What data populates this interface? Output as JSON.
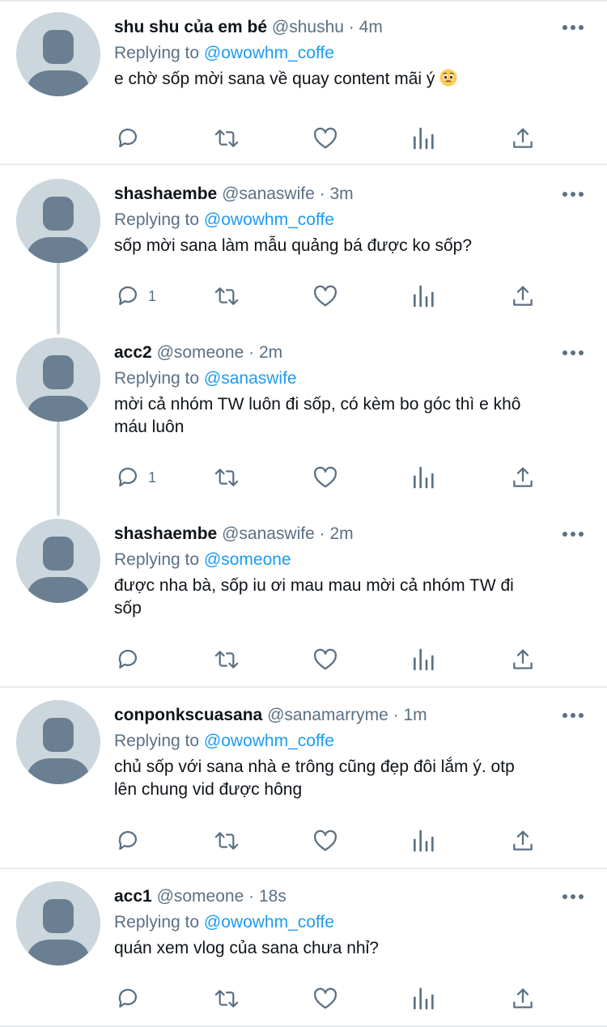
{
  "colors": {
    "accent": "#1d9bf0",
    "secondary_text": "#5b7083",
    "avatar_bg": "#ccd6dd",
    "avatar_figure": "#6a7f91",
    "separator": "#e7ebee"
  },
  "icons": {
    "more": "more-horizontal-icon",
    "reply": "reply-icon",
    "retweet": "retweet-icon",
    "like": "heart-icon",
    "analytics": "analytics-icon",
    "share": "share-icon",
    "emoji": "pleading-face-emoji"
  },
  "tweets": [
    {
      "name": "shu shu của em bé",
      "handle": "@shushu",
      "dot": "·",
      "time": "4m",
      "replying_label": "Replying to",
      "replying_to": "@owowhm_coffe",
      "text_lines": [
        "e chờ sốp mời sana về quay content mãi ý"
      ],
      "reply_count": ""
    },
    {
      "name": "shashaembe",
      "handle": "@sanaswife",
      "dot": "·",
      "time": "3m",
      "replying_label": "Replying to",
      "replying_to": "@owowhm_coffe",
      "text_lines": [
        "sốp mời sana làm mẫu quảng bá được ko sốp?"
      ],
      "reply_count": "1"
    },
    {
      "name": "acc2",
      "handle": "@someone",
      "dot": "·",
      "time": "2m",
      "replying_label": "Replying to",
      "replying_to": "@sanaswife",
      "text_lines": [
        "mời cả nhóm TW luôn đi sốp, có kèm bo góc thì e khô",
        "máu luôn"
      ],
      "reply_count": "1"
    },
    {
      "name": "shashaembe",
      "handle": "@sanaswife",
      "dot": "·",
      "time": "2m",
      "replying_label": "Replying to",
      "replying_to": "@someone",
      "text_lines": [
        "được nha bà, sốp iu ơi mau mau mời cả nhóm TW đi",
        "sốp"
      ],
      "reply_count": ""
    },
    {
      "name": "conponkscuasana",
      "handle": "@sanamarryme",
      "dot": "·",
      "time": "1m",
      "replying_label": "Replying to",
      "replying_to": "@owowhm_coffe",
      "text_lines": [
        "chủ sốp với sana nhà e trông cũng đẹp đôi lắm ý. otp",
        "lên chung vid được hông"
      ],
      "reply_count": ""
    },
    {
      "name": "acc1",
      "handle": "@someone",
      "dot": "·",
      "time": "18s",
      "replying_label": "Replying to",
      "replying_to": "@owowhm_coffe",
      "text_lines": [
        "quán xem vlog của sana chưa nhỉ?"
      ],
      "reply_count": ""
    }
  ]
}
